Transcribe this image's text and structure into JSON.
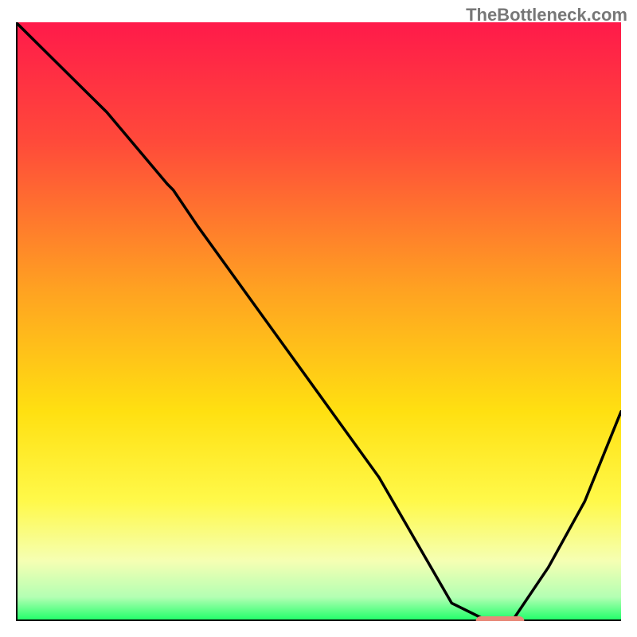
{
  "watermark": "TheBottleneck.com",
  "chart_data": {
    "type": "line",
    "title": "",
    "xlabel": "",
    "ylabel": "",
    "xlim": [
      0,
      100
    ],
    "ylim": [
      0,
      100
    ],
    "background_gradient": {
      "stops": [
        {
          "offset": 0,
          "color": "#ff1a4a"
        },
        {
          "offset": 20,
          "color": "#ff4a3a"
        },
        {
          "offset": 45,
          "color": "#ffa321"
        },
        {
          "offset": 65,
          "color": "#ffe011"
        },
        {
          "offset": 80,
          "color": "#fff94a"
        },
        {
          "offset": 90,
          "color": "#f5ffb3"
        },
        {
          "offset": 96,
          "color": "#b3ffb3"
        },
        {
          "offset": 100,
          "color": "#1aff66"
        }
      ]
    },
    "series": [
      {
        "name": "bottleneck-curve",
        "color": "#000000",
        "x": [
          0,
          5,
          10,
          15,
          20,
          25,
          26,
          30,
          40,
          50,
          60,
          68,
          72,
          78,
          82,
          88,
          94,
          100
        ],
        "y": [
          100,
          95,
          90,
          85,
          79,
          73,
          72,
          66,
          52,
          38,
          24,
          10,
          3,
          0,
          0,
          9,
          20,
          35
        ]
      }
    ],
    "marker": {
      "name": "target-marker",
      "x": 80,
      "y": 0,
      "width": 8,
      "color": "#e88a7a"
    },
    "axes": {
      "left": {
        "x": 0,
        "y0": 0,
        "y1": 100
      },
      "bottom": {
        "y": 0,
        "x0": 0,
        "x1": 100
      }
    }
  }
}
